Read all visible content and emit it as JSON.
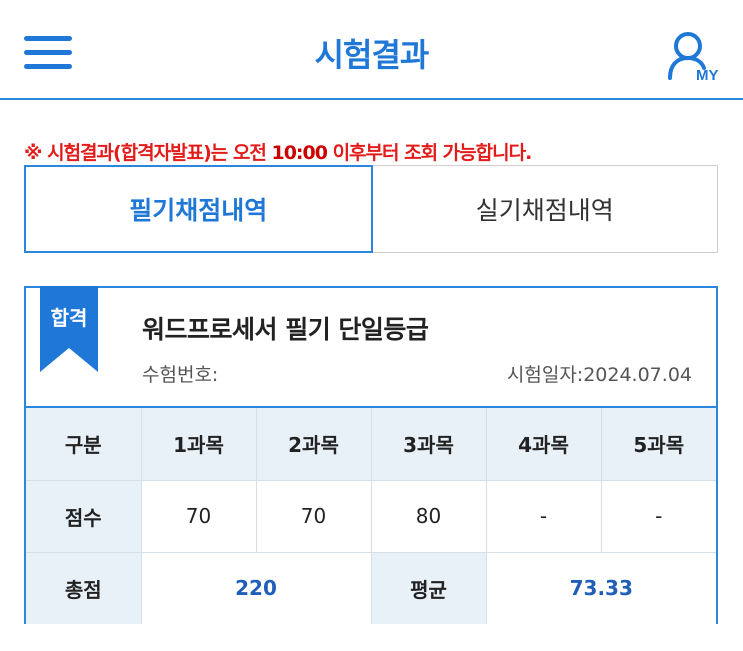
{
  "header": {
    "title": "시험결과",
    "menu_icon": "hamburger-menu-icon",
    "my_label": "MY",
    "accent_color": "#1f78d7"
  },
  "notice": {
    "mark": "※",
    "before": " 시험결과(합격자발표)는 오전 ",
    "time": "10:00",
    "after": " 이후부터 조회 가능합니다.",
    "color": "#e21b1b"
  },
  "tabs": [
    {
      "label": "필기채점내역",
      "active": true
    },
    {
      "label": "실기채점내역",
      "active": false
    }
  ],
  "result": {
    "badge": "합격",
    "exam_name": "워드프로세서 필기 단일등급",
    "exam_number_label": "수험번호:",
    "exam_date_label": "시험일자:",
    "exam_date": "2024.07.04",
    "headers": [
      "구분",
      "1과목",
      "2과목",
      "3과목",
      "4과목",
      "5과목"
    ],
    "score_label": "점수",
    "scores": [
      "70",
      "70",
      "80",
      "-",
      "-"
    ],
    "total_label": "총점",
    "total": "220",
    "average_label": "평균",
    "average": "73.33"
  }
}
